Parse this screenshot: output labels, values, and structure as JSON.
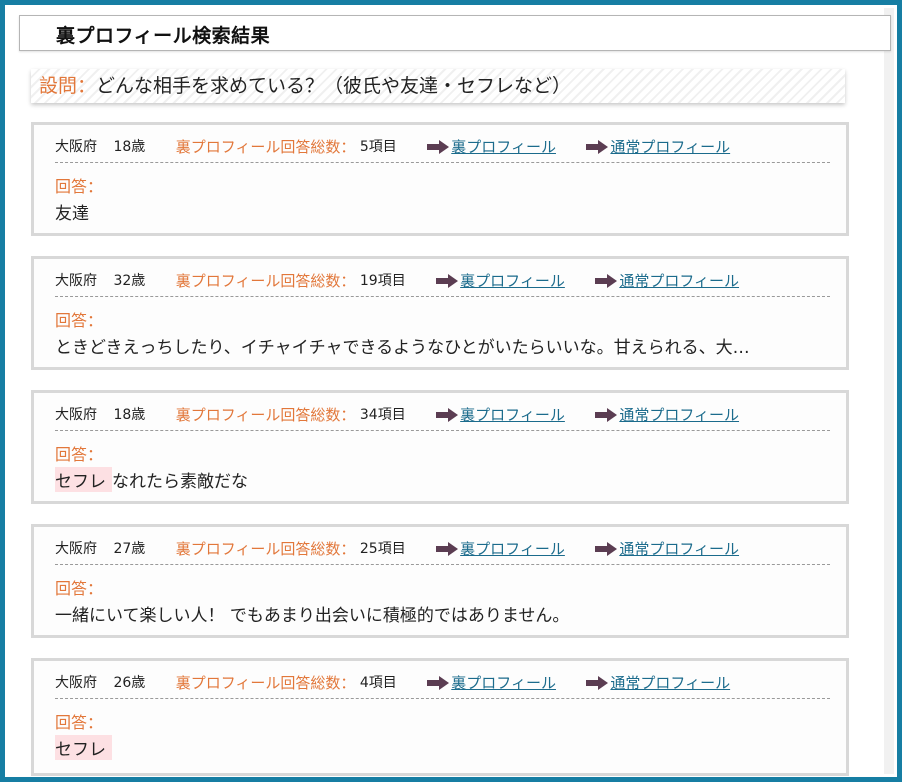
{
  "header": {
    "title": "裏プロフィール検索結果"
  },
  "question": {
    "label": "設問：",
    "text": "どんな相手を求めている？（彼氏や友達・セフレなど）"
  },
  "labels": {
    "count_label": "裏プロフィール回答総数：",
    "ura_link": "裏プロフィール",
    "normal_link": "通常プロフィール",
    "answer_label": "回答："
  },
  "colors": {
    "accent": "#e2773a",
    "frame": "#167ea3",
    "link": "#1b6b8c",
    "highlight": "#fde0e3",
    "arrow": "#5b3d52"
  },
  "results": [
    {
      "prefecture": "大阪府",
      "age": "18歳",
      "count": "5項目",
      "answer_highlight": "",
      "answer_rest": "友達"
    },
    {
      "prefecture": "大阪府",
      "age": "32歳",
      "count": "19項目",
      "answer_highlight": "",
      "answer_rest": "ときどきえっちしたり、イチャイチャできるようなひとがいたらいいな。甘えられる、大…"
    },
    {
      "prefecture": "大阪府",
      "age": "18歳",
      "count": "34項目",
      "answer_highlight": "セフレ",
      "answer_rest": "なれたら素敵だな"
    },
    {
      "prefecture": "大阪府",
      "age": "27歳",
      "count": "25項目",
      "answer_highlight": "",
      "answer_rest": "一緒にいて楽しい人！ でもあまり出会いに積極的ではありません。"
    },
    {
      "prefecture": "大阪府",
      "age": "26歳",
      "count": "4項目",
      "answer_highlight": "セフレ",
      "answer_rest": ""
    }
  ]
}
